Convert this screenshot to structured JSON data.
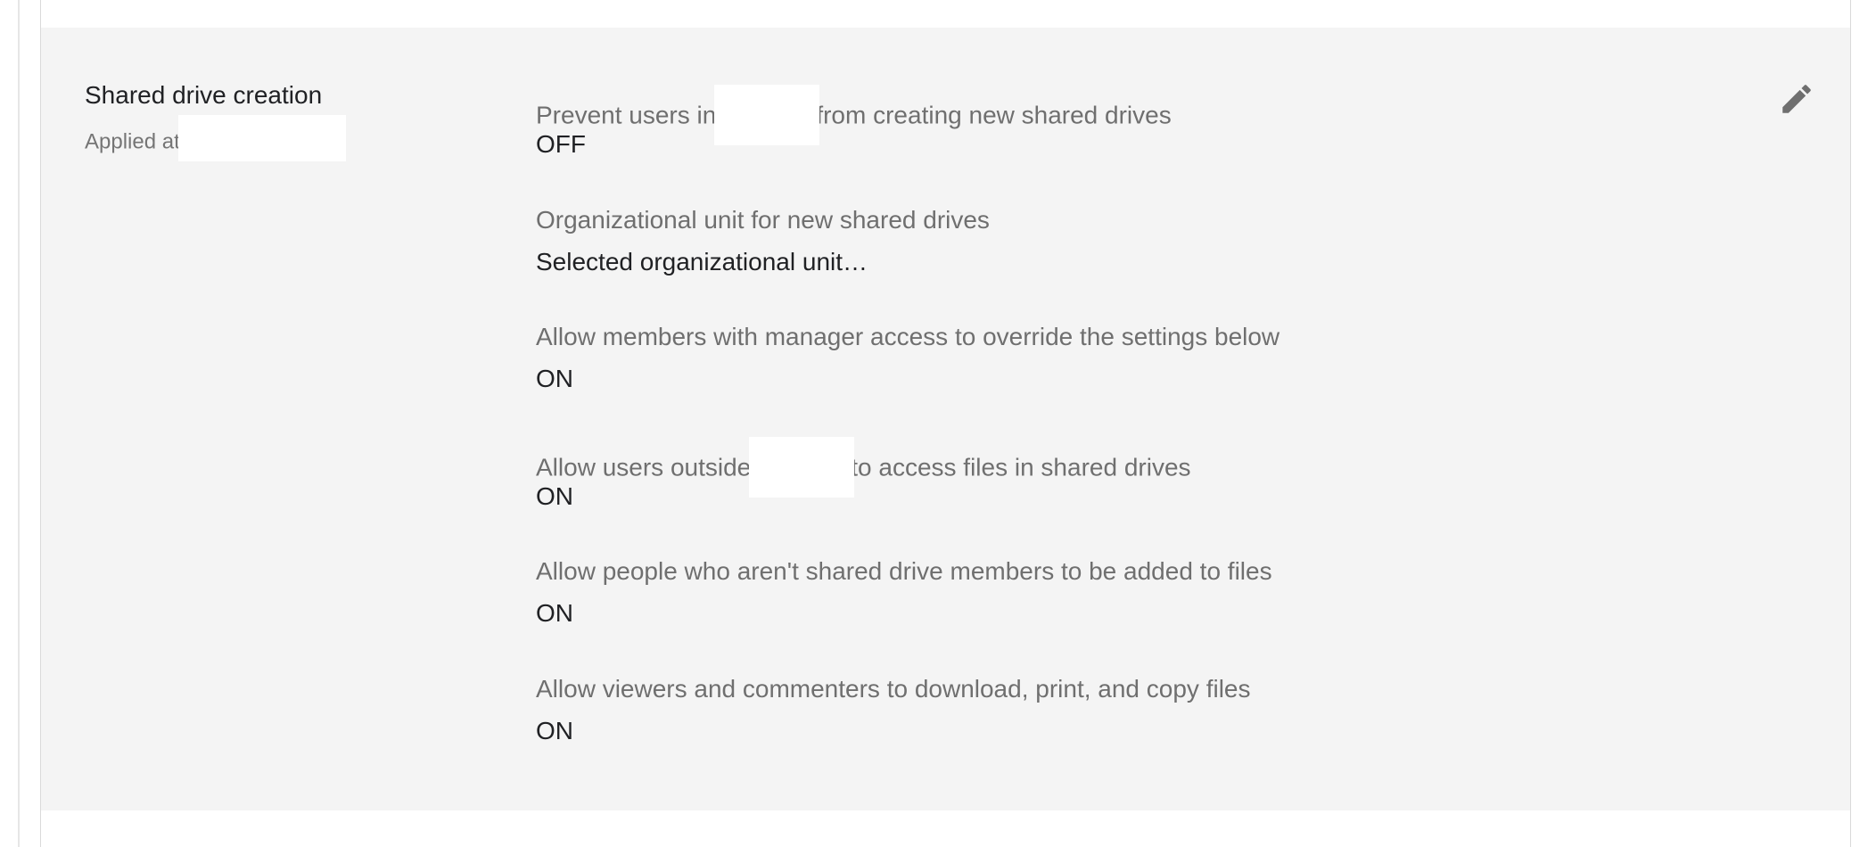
{
  "section": {
    "title": "Shared drive creation",
    "applied_at_label": "Applied at",
    "edit_icon": "pencil-icon"
  },
  "settings": [
    {
      "label_before": "Prevent users in",
      "label_after": "from creating new shared drives",
      "value": "OFF"
    },
    {
      "label": "Organizational unit for new shared drives",
      "value": "Selected organizational unit…"
    },
    {
      "label": "Allow members with manager access to override the settings below",
      "value": "ON"
    },
    {
      "label_before": "Allow users outside",
      "label_after": "to access files in shared drives",
      "value": "ON"
    },
    {
      "label": "Allow people who aren't shared drive members to be added to files",
      "value": "ON"
    },
    {
      "label": "Allow viewers and commenters to download, print, and copy files",
      "value": "ON"
    }
  ],
  "colors": {
    "panel_bg": "#f4f4f4",
    "label": "#6f6f6f",
    "value": "#202124",
    "icon": "#6f6f6f"
  }
}
